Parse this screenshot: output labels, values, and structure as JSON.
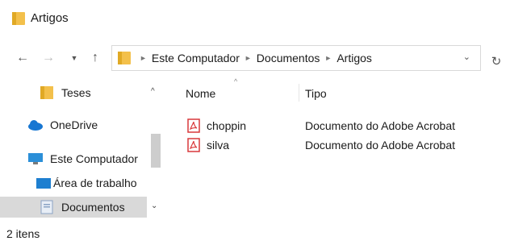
{
  "window": {
    "title": "Artigos"
  },
  "address": {
    "crumbs": [
      "Este Computador",
      "Documentos",
      "Artigos"
    ]
  },
  "nav": {
    "items": [
      {
        "label": "Teses",
        "icon": "folder-icon"
      },
      {
        "label": "OneDrive",
        "icon": "cloud-icon"
      },
      {
        "label": "Este Computador",
        "icon": "computer-icon"
      },
      {
        "label": "Área de trabalho",
        "icon": "desktop-icon"
      },
      {
        "label": "Documentos",
        "icon": "documents-icon",
        "selected": true
      }
    ]
  },
  "columns": {
    "name": "Nome",
    "type": "Tipo"
  },
  "files": [
    {
      "name": "choppin",
      "type": "Documento do Adobe Acrobat",
      "icon": "pdf-icon"
    },
    {
      "name": "silva",
      "type": "Documento do Adobe Acrobat",
      "icon": "pdf-icon"
    }
  ],
  "status": {
    "count": "2 itens"
  },
  "colors": {
    "folder": "#f3c04b",
    "pdf": "#d9393b",
    "selected": "#d9d9d9",
    "onedrive": "#1776d2"
  }
}
